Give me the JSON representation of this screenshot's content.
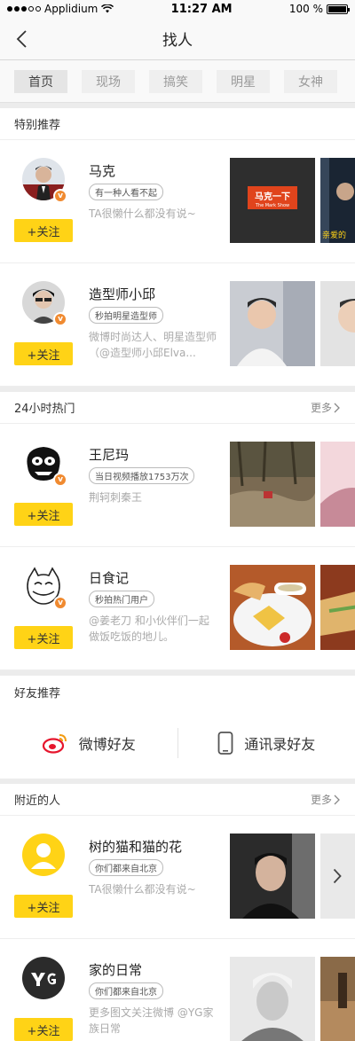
{
  "status": {
    "carrier": "Applidium",
    "time": "11:27 AM",
    "battery": "100 %"
  },
  "nav": {
    "title": "找人"
  },
  "tabs": [
    "首页",
    "现场",
    "搞笑",
    "明星",
    "女神"
  ],
  "sections": {
    "special": {
      "title": "特别推荐"
    },
    "hot": {
      "title": "24小时热门",
      "more": "更多"
    },
    "friends": {
      "title": "好友推荐",
      "weibo": "微博好友",
      "contacts": "通讯录好友"
    },
    "nearby": {
      "title": "附近的人",
      "more": "更多"
    }
  },
  "follow_label": "+关注",
  "users": {
    "u1": {
      "name": "马克",
      "tag": "有一种人看不起",
      "desc": "TA很懒什么都没有说~",
      "thumb_text": "马克一下",
      "thumb_sub": "The Mark Show",
      "thumb2_text": "亲爱的"
    },
    "u2": {
      "name": "造型师小邱",
      "tag": "秒拍明星造型师",
      "desc": "微博时尚达人、明星造型师（@造型师小邱Elva..."
    },
    "u3": {
      "name": "王尼玛",
      "tag": "当日视频播放1753万次",
      "desc": "荆轲刺秦王"
    },
    "u4": {
      "name": "日食记",
      "tag": "秒拍热门用户",
      "desc": "@姜老刀 和小伙伴们一起做饭吃饭的地儿。"
    },
    "u5": {
      "name": "树的猫和猫的花",
      "tag": "你们都来自北京",
      "desc": "TA很懒什么都没有说~"
    },
    "u6": {
      "name": "家的日常",
      "tag": "你们都来自北京",
      "desc": "更多图文关注微博 @YG家族日常"
    }
  },
  "colors": {
    "accent": "#ffd316",
    "badge": "#f08a30",
    "weibo": "#e6162d"
  }
}
